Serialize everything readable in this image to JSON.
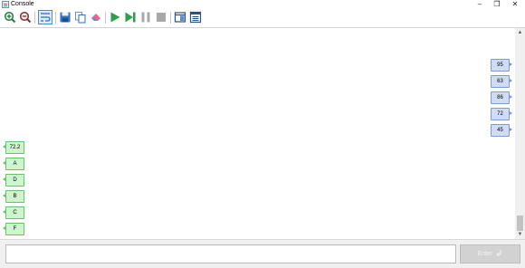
{
  "window": {
    "title": "Console",
    "minimize": "–",
    "maximize": "❐",
    "close": "✕"
  },
  "toolbar": {
    "buttons": [
      {
        "name": "zoom-in-button",
        "icon": "zoom-in-icon"
      },
      {
        "name": "zoom-out-button",
        "icon": "zoom-out-icon"
      },
      {
        "name": "wrap-text-button",
        "icon": "wrap-text-icon"
      },
      {
        "name": "save-button",
        "icon": "save-icon"
      },
      {
        "name": "copy-button",
        "icon": "copy-icon"
      },
      {
        "name": "clear-button",
        "icon": "eraser-icon"
      },
      {
        "name": "run-button",
        "icon": "play-icon"
      },
      {
        "name": "step-button",
        "icon": "step-icon"
      },
      {
        "name": "pause-button",
        "icon": "pause-icon"
      },
      {
        "name": "stop-button",
        "icon": "stop-icon"
      },
      {
        "name": "split-view-button",
        "icon": "split-view-icon"
      },
      {
        "name": "layout-button",
        "icon": "layout-icon"
      }
    ]
  },
  "console": {
    "inputs": [
      "95",
      "63",
      "86",
      "72",
      "45"
    ],
    "outputs": [
      "72.2",
      "A",
      "D",
      "B",
      "C",
      "F"
    ]
  },
  "input_bar": {
    "value": "",
    "placeholder": "",
    "enter_label": "Enter"
  },
  "colors": {
    "input_bubble": "#cfdcf4",
    "output_bubble": "#cff5cf",
    "accent_green": "#2e9e4a",
    "accent_blue": "#2f6fc4"
  }
}
